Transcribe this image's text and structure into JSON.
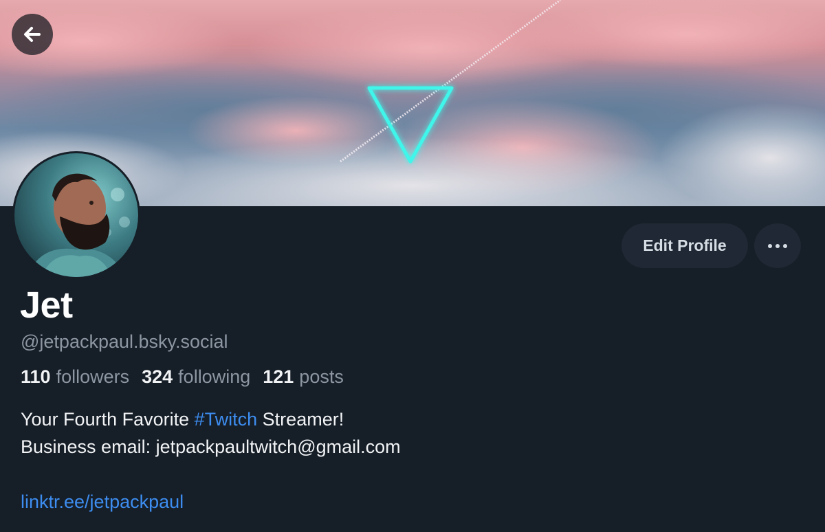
{
  "header": {
    "back_icon": "arrow-left-icon"
  },
  "profile": {
    "display_name": "Jet",
    "handle": "@jetpackpaul.bsky.social",
    "edit_profile_label": "Edit Profile",
    "more_icon": "more-horizontal-icon",
    "stats": {
      "followers_count": "110",
      "followers_label": "followers",
      "following_count": "324",
      "following_label": "following",
      "posts_count": "121",
      "posts_label": "posts"
    },
    "bio": {
      "line1_prefix": "Your Fourth Favorite ",
      "line1_hashtag": "#Twitch",
      "line1_suffix": " Streamer!",
      "line2": "Business email: jetpackpaultwitch@gmail.com",
      "link": "linktr.ee/jetpackpaul"
    }
  },
  "colors": {
    "background": "#161e27",
    "link": "#3d8df0",
    "muted_text": "#8c97a3",
    "button_bg": "#1f2834",
    "accent_neon": "#3ff5ea"
  }
}
